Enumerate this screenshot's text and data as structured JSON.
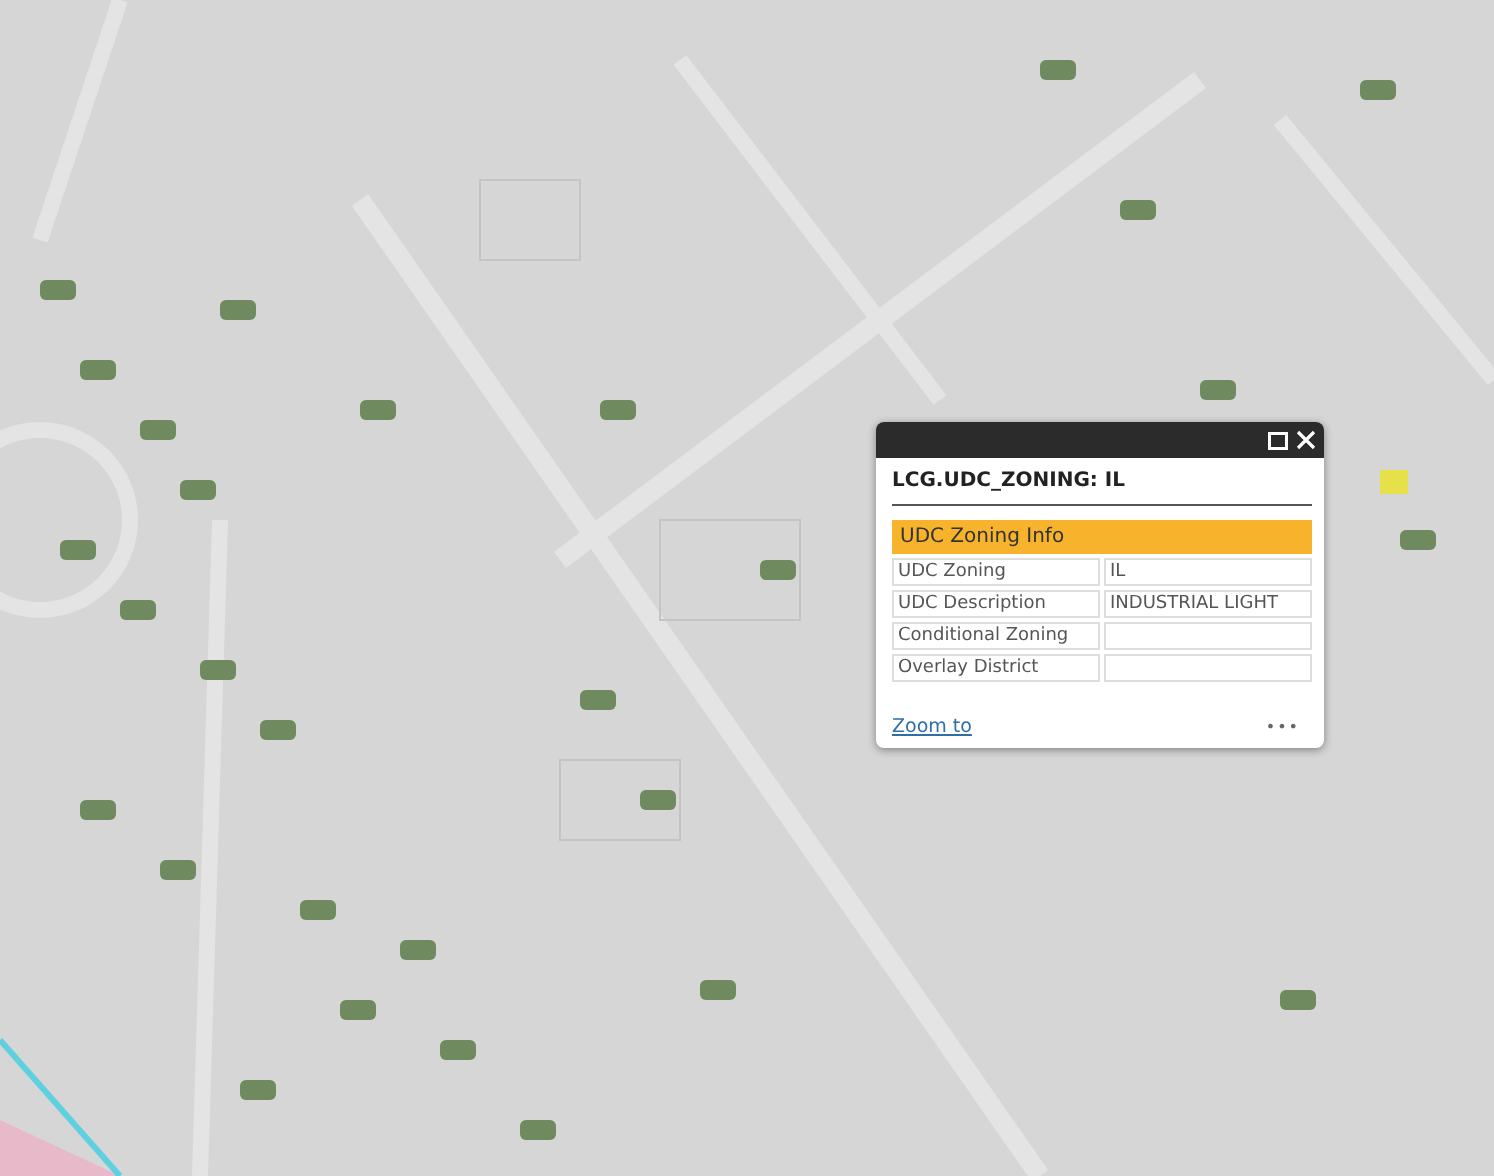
{
  "popup": {
    "title": "LCG.UDC_ZONING: IL",
    "section": "UDC Zoning Info",
    "rows": [
      {
        "label": "UDC Zoning",
        "value": "IL"
      },
      {
        "label": "UDC Description",
        "value": "INDUSTRIAL LIGHT"
      },
      {
        "label": "Conditional Zoning",
        "value": ""
      },
      {
        "label": "Overlay District",
        "value": ""
      }
    ],
    "link": "Zoom to",
    "more": "•••"
  }
}
